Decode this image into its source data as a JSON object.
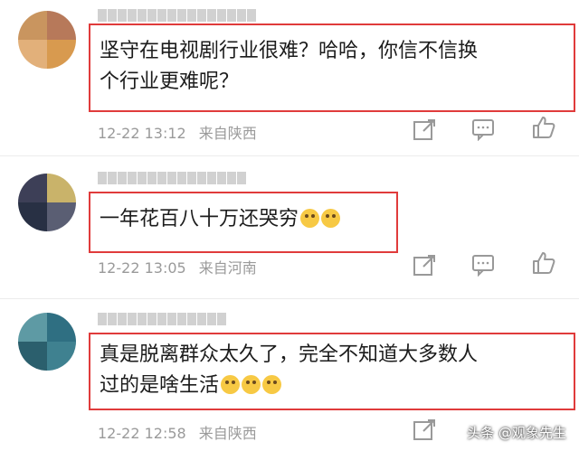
{
  "comments": [
    {
      "text_line1": "坚守在电视剧行业很难？哈哈，你信不信换",
      "text_line2": "个行业更难呢？",
      "time": "12-22 13:12",
      "location": "来自陕西",
      "emoji_count": 0
    },
    {
      "text_line1": "一年花百八十万还哭穷",
      "text_line2": "",
      "time": "12-22 13:05",
      "location": "来自河南",
      "emoji_count": 2
    },
    {
      "text_line1": "真是脱离群众太久了，完全不知道大多数人",
      "text_line2": "过的是啥生活",
      "time": "12-22 12:58",
      "location": "来自陕西",
      "emoji_count": 3
    }
  ],
  "icons": [
    "share-icon",
    "comment-icon",
    "like-icon"
  ],
  "colors": {
    "highlight_border": "#e03b3b",
    "meta_text": "#9a9a9a"
  },
  "watermark": "头条 @观象先生"
}
